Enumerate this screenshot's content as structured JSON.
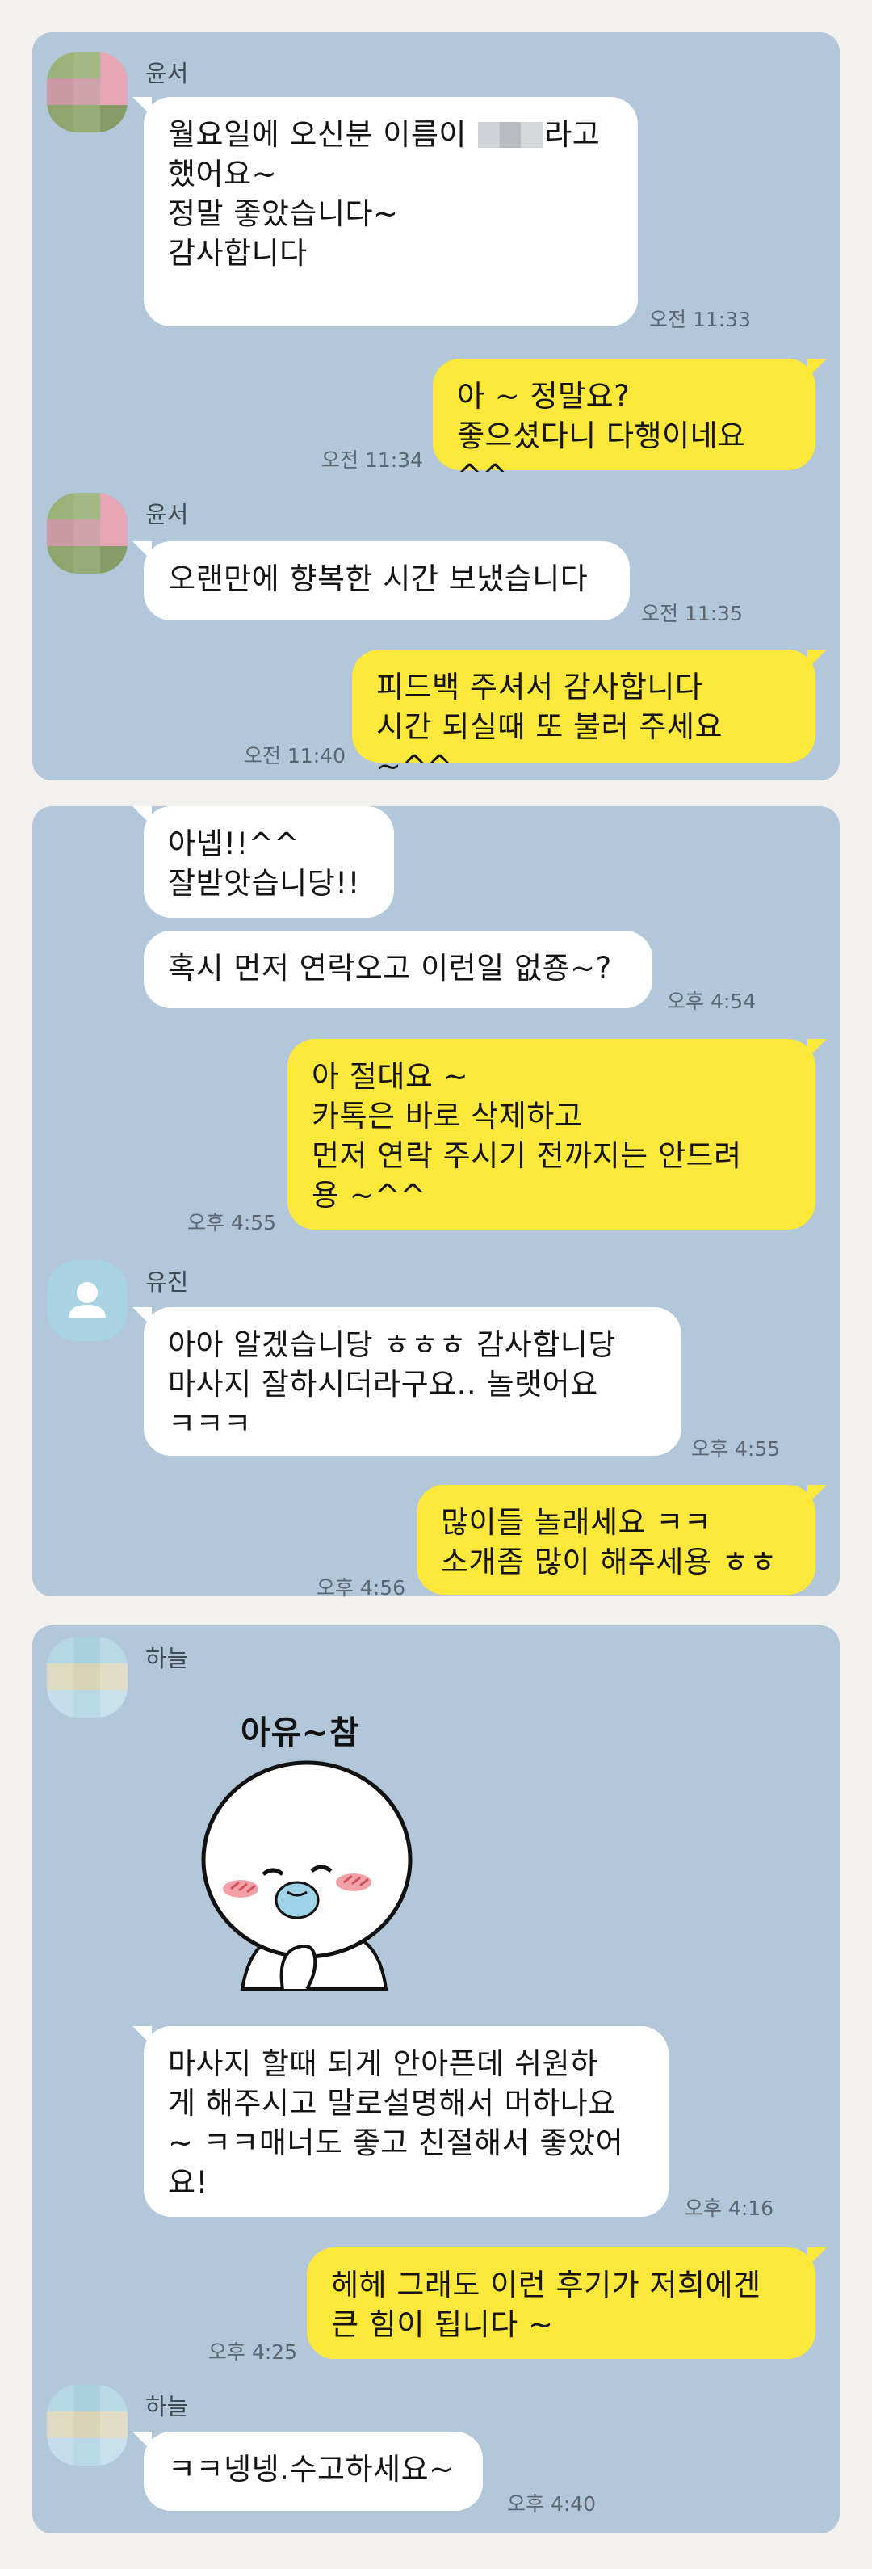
{
  "panels": [
    {
      "messages": {
        "m1": {
          "sender": "윤서",
          "text_before": "월요일에 오신분 이름이 ",
          "text_after": "라고\n했어요~\n정말 좋았습니다~\n감사합니다",
          "time": "오전 11:33"
        },
        "m2": {
          "text": "아 ~ 정말요?\n좋으셨다니 다행이네요 ^^",
          "time": "오전 11:34"
        },
        "m3": {
          "sender": "윤서",
          "text": "오랜만에 향복한 시간 보냈습니다",
          "time": "오전 11:35"
        },
        "m4": {
          "text": "피드백 주셔서 감사합니다\n시간 되실때 또 불러 주세요 ~^^",
          "time": "오전 11:40"
        }
      }
    },
    {
      "messages": {
        "m1": {
          "text": "아넵!!^^\n잘받앗습니당!!"
        },
        "m2": {
          "text": "혹시 먼저 연락오고 이런일 없죵~?",
          "time": "오후 4:54"
        },
        "m3": {
          "text": "아 절대요 ~\n카톡은 바로 삭제하고\n먼저 연락 주시기 전까지는 안드려\n용 ~^^",
          "time": "오후 4:55"
        },
        "m4": {
          "sender": "유진",
          "text": "아아 알겠습니당 ㅎㅎㅎ 감사합니당\n마사지 잘하시더라구요.. 놀랫어요\nㅋㅋㅋ",
          "time": "오후 4:55"
        },
        "m5": {
          "text": "많이들 놀래세요 ㅋㅋ\n소개좀 많이 해주세용 ㅎㅎ",
          "time": "오후 4:56"
        }
      }
    },
    {
      "messages": {
        "sticker": {
          "sender": "하늘",
          "caption": "아유~참"
        },
        "m1": {
          "text": "마사지 할때 되게 안아픈데 쉬원하\n게 해주시고 말로설명해서 머하나요\n~ ㅋㅋ매너도 좋고 친절해서 좋았어\n요!",
          "time": "오후 4:16"
        },
        "m2": {
          "text": "헤헤 그래도 이런 후기가 저희에겐\n큰 힘이 됩니다 ~",
          "time": "오후 4:25"
        },
        "m3": {
          "sender": "하늘",
          "text": "ㅋㅋ넹넹.수고하세요~",
          "time": "오후 4:40"
        }
      }
    }
  ],
  "colors": {
    "chat_background": "#b2c7da",
    "incoming_bubble": "#ffffff",
    "outgoing_bubble": "#fee83b",
    "page_background": "#f3f1ee"
  },
  "icons": {
    "default_avatar": "person-icon",
    "blurred_avatar": "pixelated-profile-photo"
  }
}
